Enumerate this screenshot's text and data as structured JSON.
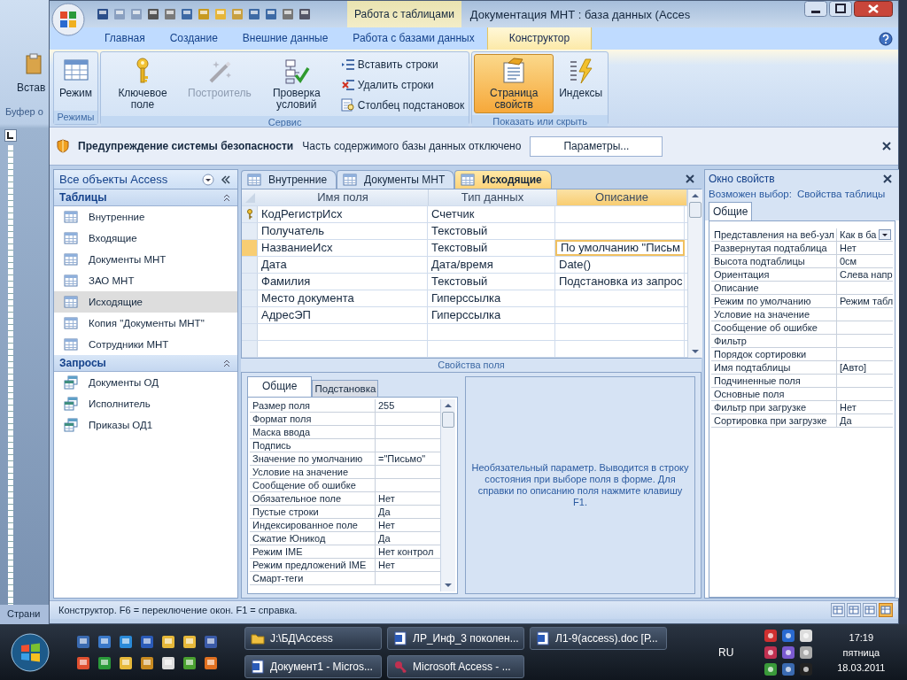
{
  "background_window": {
    "button": "Встав",
    "group": "Буфер о",
    "status": "Страни"
  },
  "window": {
    "context_tab": "Работа с таблицами",
    "title": "Документация МНТ : база данных (Acces"
  },
  "ribbon": {
    "tabs": [
      {
        "label": "Главная",
        "selected": false
      },
      {
        "label": "Создание",
        "selected": false
      },
      {
        "label": "Внешние данные",
        "selected": false
      },
      {
        "label": "Работа с базами данных",
        "selected": false
      },
      {
        "label": "Конструктор",
        "selected": true
      }
    ],
    "groups": [
      {
        "label": "Режимы",
        "items": [
          {
            "label": "Режим",
            "kind": "large",
            "disabled": false,
            "selected": false
          }
        ]
      },
      {
        "label": "Сервис",
        "items": [
          {
            "label": "Ключевое поле",
            "kind": "large",
            "disabled": false,
            "selected": false
          },
          {
            "label": "Построитель",
            "kind": "large",
            "disabled": true,
            "selected": false
          },
          {
            "label": "Проверка условий",
            "kind": "large",
            "disabled": false,
            "selected": false
          },
          {
            "label": "Вставить строки",
            "kind": "small",
            "disabled": false,
            "selected": false
          },
          {
            "label": "Удалить строки",
            "kind": "small",
            "disabled": false,
            "selected": false
          },
          {
            "label": "Столбец  подстановок",
            "kind": "small",
            "disabled": false,
            "selected": false
          }
        ]
      },
      {
        "label": "Показать или скрыть",
        "items": [
          {
            "label": "Страница свойств",
            "kind": "large",
            "disabled": false,
            "selected": true
          },
          {
            "label": "Индексы",
            "kind": "large",
            "disabled": false,
            "selected": false
          }
        ]
      }
    ]
  },
  "security_bar": {
    "title": "Предупреждение системы безопасности",
    "message": "Часть содержимого базы данных отключено",
    "button": "Параметры..."
  },
  "nav_pane": {
    "title": "Все объекты Access",
    "groups": [
      {
        "label": "Таблицы",
        "expanded": true,
        "items": [
          {
            "label": "Внутренние",
            "kind": "table",
            "selected": false
          },
          {
            "label": "Входящие",
            "kind": "table",
            "selected": false
          },
          {
            "label": "Документы МНТ",
            "kind": "table",
            "selected": false
          },
          {
            "label": "ЗАО МНТ",
            "kind": "table",
            "selected": false
          },
          {
            "label": "Исходящие",
            "kind": "table",
            "selected": true
          },
          {
            "label": "Копия \"Документы МНТ\"",
            "kind": "table",
            "selected": false
          },
          {
            "label": "Сотрудники МНТ",
            "kind": "table",
            "selected": false
          }
        ]
      },
      {
        "label": "Запросы",
        "expanded": true,
        "items": [
          {
            "label": "Документы ОД",
            "kind": "query",
            "selected": false
          },
          {
            "label": "Исполнитель",
            "kind": "query",
            "selected": false
          },
          {
            "label": "Приказы ОД1",
            "kind": "query",
            "selected": false
          }
        ]
      }
    ]
  },
  "document_tabs": [
    {
      "label": "Внутренние",
      "selected": false
    },
    {
      "label": "Документы МНТ",
      "selected": false
    },
    {
      "label": "Исходящие",
      "selected": true
    }
  ],
  "design_grid": {
    "columns": [
      {
        "label": "Имя поля",
        "selected": false
      },
      {
        "label": "Тип данных",
        "selected": false
      },
      {
        "label": "Описание",
        "selected": true
      }
    ],
    "rows": [
      {
        "name": "КодРегистрИсх",
        "type": "Счетчик",
        "primary_key": true,
        "selected": false
      },
      {
        "name": "Получатель",
        "type": "Текстовый",
        "primary_key": false,
        "selected": false
      },
      {
        "name": "НазваниеИсх",
        "type": "Текстовый",
        "description": "По умолчанию \"Письм",
        "primary_key": false,
        "selected": true
      },
      {
        "name": "Дата",
        "type": "Дата/время",
        "description": "Date()",
        "primary_key": false,
        "selected": false
      },
      {
        "name": "Фамилия",
        "type": "Текстовый",
        "description": "Подстановка из запрос",
        "primary_key": false,
        "selected": false
      },
      {
        "name": "Место документа",
        "type": "Гиперссылка",
        "primary_key": false,
        "selected": false
      },
      {
        "name": "АдресЭП",
        "type": "Гиперссылка",
        "primary_key": false,
        "selected": false
      }
    ]
  },
  "field_properties": {
    "title": "Свойства поля",
    "tabs": [
      {
        "label": "Общие",
        "selected": true
      },
      {
        "label": "Подстановка",
        "selected": false
      }
    ],
    "rows": [
      {
        "label": "Размер поля",
        "value": "255"
      },
      {
        "label": "Формат поля"
      },
      {
        "label": "Маска ввода"
      },
      {
        "label": "Подпись"
      },
      {
        "label": "Значение по умолчанию",
        "value": "=\"Письмо\""
      },
      {
        "label": "Условие на значение"
      },
      {
        "label": "Сообщение об ошибке"
      },
      {
        "label": "Обязательное поле",
        "value": "Нет"
      },
      {
        "label": "Пустые строки",
        "value": "Да"
      },
      {
        "label": "Индексированное поле",
        "value": "Нет"
      },
      {
        "label": "Сжатие Юникод",
        "value": "Да"
      },
      {
        "label": "Режим IME",
        "value": "Нет контрол"
      },
      {
        "label": "Режим предложений IME",
        "value": "Нет"
      },
      {
        "label": "Смарт-теги"
      }
    ],
    "help": "Необязательный параметр.  Выводится в строку состояния при выборе поля в форме. Для справки по описанию поля нажмите клавишу F1."
  },
  "property_sheet": {
    "title": "Окно свойств",
    "selection_label": "Возможен выбор:",
    "selection": "Свойства таблицы",
    "tabs": [
      {
        "label": "Общие",
        "selected": true
      }
    ],
    "rows": [
      {
        "label": "Представления на веб-узл",
        "value": "Как в ба",
        "kind": "dropdown"
      },
      {
        "label": "Развернутая подтаблица",
        "value": "Нет",
        "kind": "text"
      },
      {
        "label": "Высота подтаблицы",
        "value": "0см",
        "kind": "text"
      },
      {
        "label": "Ориентация",
        "value": "Слева напр",
        "kind": "text"
      },
      {
        "label": "Описание",
        "kind": "text"
      },
      {
        "label": "Режим по умолчанию",
        "value": "Режим табл",
        "kind": "text"
      },
      {
        "label": "Условие на значение",
        "kind": "text"
      },
      {
        "label": "Сообщение об ошибке",
        "kind": "text"
      },
      {
        "label": "Фильтр",
        "kind": "text"
      },
      {
        "label": "Порядок сортировки",
        "kind": "text"
      },
      {
        "label": "Имя подтаблицы",
        "value": "[Авто]",
        "kind": "text"
      },
      {
        "label": "Подчиненные поля",
        "kind": "text"
      },
      {
        "label": "Основные поля",
        "kind": "text"
      },
      {
        "label": "Фильтр при загрузке",
        "value": "Нет",
        "kind": "text"
      },
      {
        "label": "Сортировка при загрузке",
        "value": "Да",
        "kind": "text"
      }
    ]
  },
  "status_bar": {
    "text": "Конструктор. F6 = переключение окон. F1 = справка.",
    "view_buttons": [
      {
        "selected": false
      },
      {
        "selected": false
      },
      {
        "selected": false
      },
      {
        "selected": true
      }
    ]
  },
  "taskbar": {
    "tasks": [
      {
        "label": "J:\\БД\\Access",
        "kind": "folder"
      },
      {
        "label": "ЛР_Инф_3 поколен...",
        "kind": "document"
      },
      {
        "label": "Л1-9(access).doc [Р...",
        "kind": "document"
      },
      {
        "label": "Документ1 - Micros...",
        "kind": "document"
      },
      {
        "label": "Microsoft Access - ...",
        "kind": "access"
      }
    ],
    "language": "RU",
    "time": "17:19",
    "day": "пятница",
    "date": "18.03.2011"
  }
}
